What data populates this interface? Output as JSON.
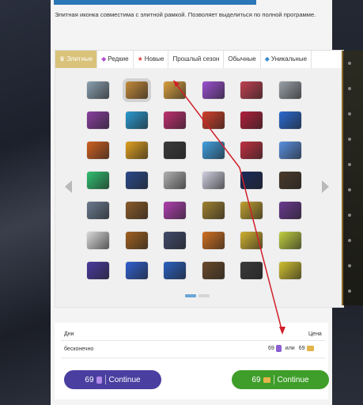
{
  "description": "Элитная иконка совместима с элитной рамкой. Позволяет выделиться по полной программе.",
  "tabs": [
    {
      "label": "Элитные",
      "icon": "crown-icon",
      "state": "active"
    },
    {
      "label": "Редкие",
      "icon": "diamond-icon",
      "state": "normal"
    },
    {
      "label": "Новые",
      "icon": "star-icon",
      "state": "selected"
    },
    {
      "label": "Прошлый сезон",
      "icon": "",
      "state": "normal"
    },
    {
      "label": "Обычные",
      "icon": "",
      "state": "normal"
    },
    {
      "label": "Уникальные",
      "icon": "gem-icon",
      "state": "normal"
    }
  ],
  "icon_colors": [
    [
      "#8aa0b0",
      "#c48a3a",
      "#d9a040",
      "#9a4fd0",
      "#c04050",
      "#9aa0a8"
    ],
    [
      "#8a3fa0",
      "#2a9ad0",
      "#c03070",
      "#d0402a",
      "#b0203a",
      "#2b6ad0"
    ],
    [
      "#d06020",
      "#e0a020",
      "#3a3a3a",
      "#40a0e0",
      "#c03040",
      "#5a90e0"
    ],
    [
      "#30c070",
      "#2a4a8a",
      "#b0b0b0",
      "#d0d0e0",
      "#1a2a5a",
      "#4a3a2a"
    ],
    [
      "#6a7a90",
      "#8a5a2a",
      "#b040b0",
      "#a08030",
      "#c0a030",
      "#6a3a90"
    ],
    [
      "#d8d8d8",
      "#a06020",
      "#404a6a",
      "#d07020",
      "#d0b030",
      "#c0d040"
    ],
    [
      "#4a3aa0",
      "#3060d0",
      "#2a60c0",
      "#6a4a2a",
      "#3a3a3a",
      "#d0c030"
    ]
  ],
  "pager": {
    "pages": 2,
    "current": 1
  },
  "price": {
    "col_days": "Дни",
    "col_price": "Цена",
    "duration": "бесконечно",
    "gem_amount": "69",
    "or": "или",
    "gold_amount": "69"
  },
  "buttons": {
    "gems_amount": "69",
    "gems_label": "Continue",
    "gold_amount": "69",
    "gold_label": "Continue"
  },
  "colors": {
    "active_tab": "#d9c27a",
    "gem_button": "#4a3fa0",
    "gold_button": "#3f9e2a",
    "annotation": "#d0202a"
  }
}
